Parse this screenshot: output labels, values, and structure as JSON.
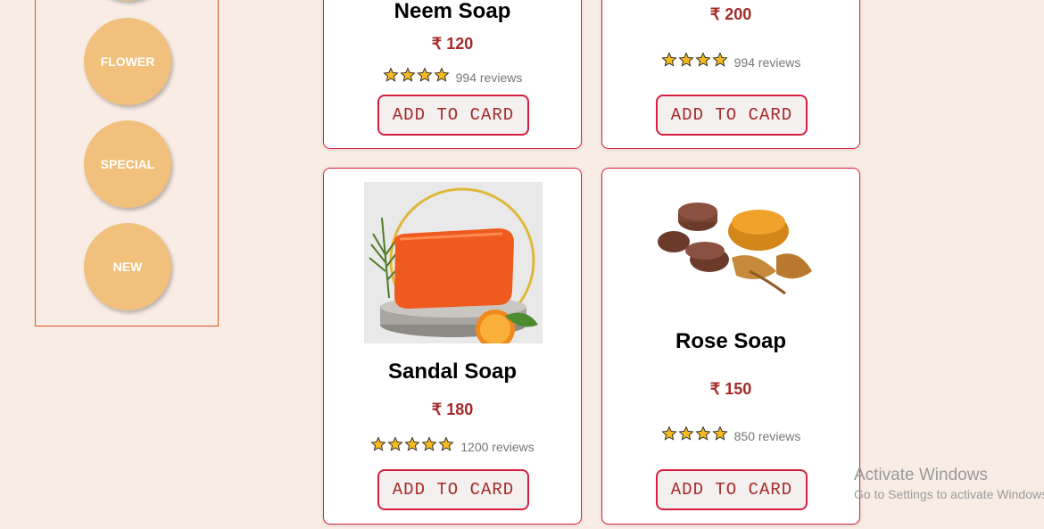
{
  "categories": [
    {
      "label": ""
    },
    {
      "label": "FLOWER"
    },
    {
      "label": "SPECIAL"
    },
    {
      "label": "NEW"
    }
  ],
  "currency_symbol": "₹",
  "add_button_label": "ADD TO CARD",
  "products": [
    {
      "name": "Neem Soap",
      "price": "₹ 120",
      "stars": 4,
      "reviews": "994 reviews"
    },
    {
      "name": "",
      "price": "₹ 200",
      "stars": 4,
      "reviews": "994 reviews"
    },
    {
      "name": "Sandal Soap",
      "price": "₹ 180",
      "stars": 5,
      "reviews": "1200 reviews"
    },
    {
      "name": "Rose Soap",
      "price": "₹ 150",
      "stars": 4,
      "reviews": "850 reviews"
    }
  ],
  "watermark": {
    "line1": "Activate Windows",
    "line2": "Go to Settings to activate Windows."
  },
  "colors": {
    "background": "#f9ece5",
    "accent": "#d4213f",
    "price": "#a52a2a",
    "category": "#f0c07c",
    "star": "#f5b921"
  }
}
